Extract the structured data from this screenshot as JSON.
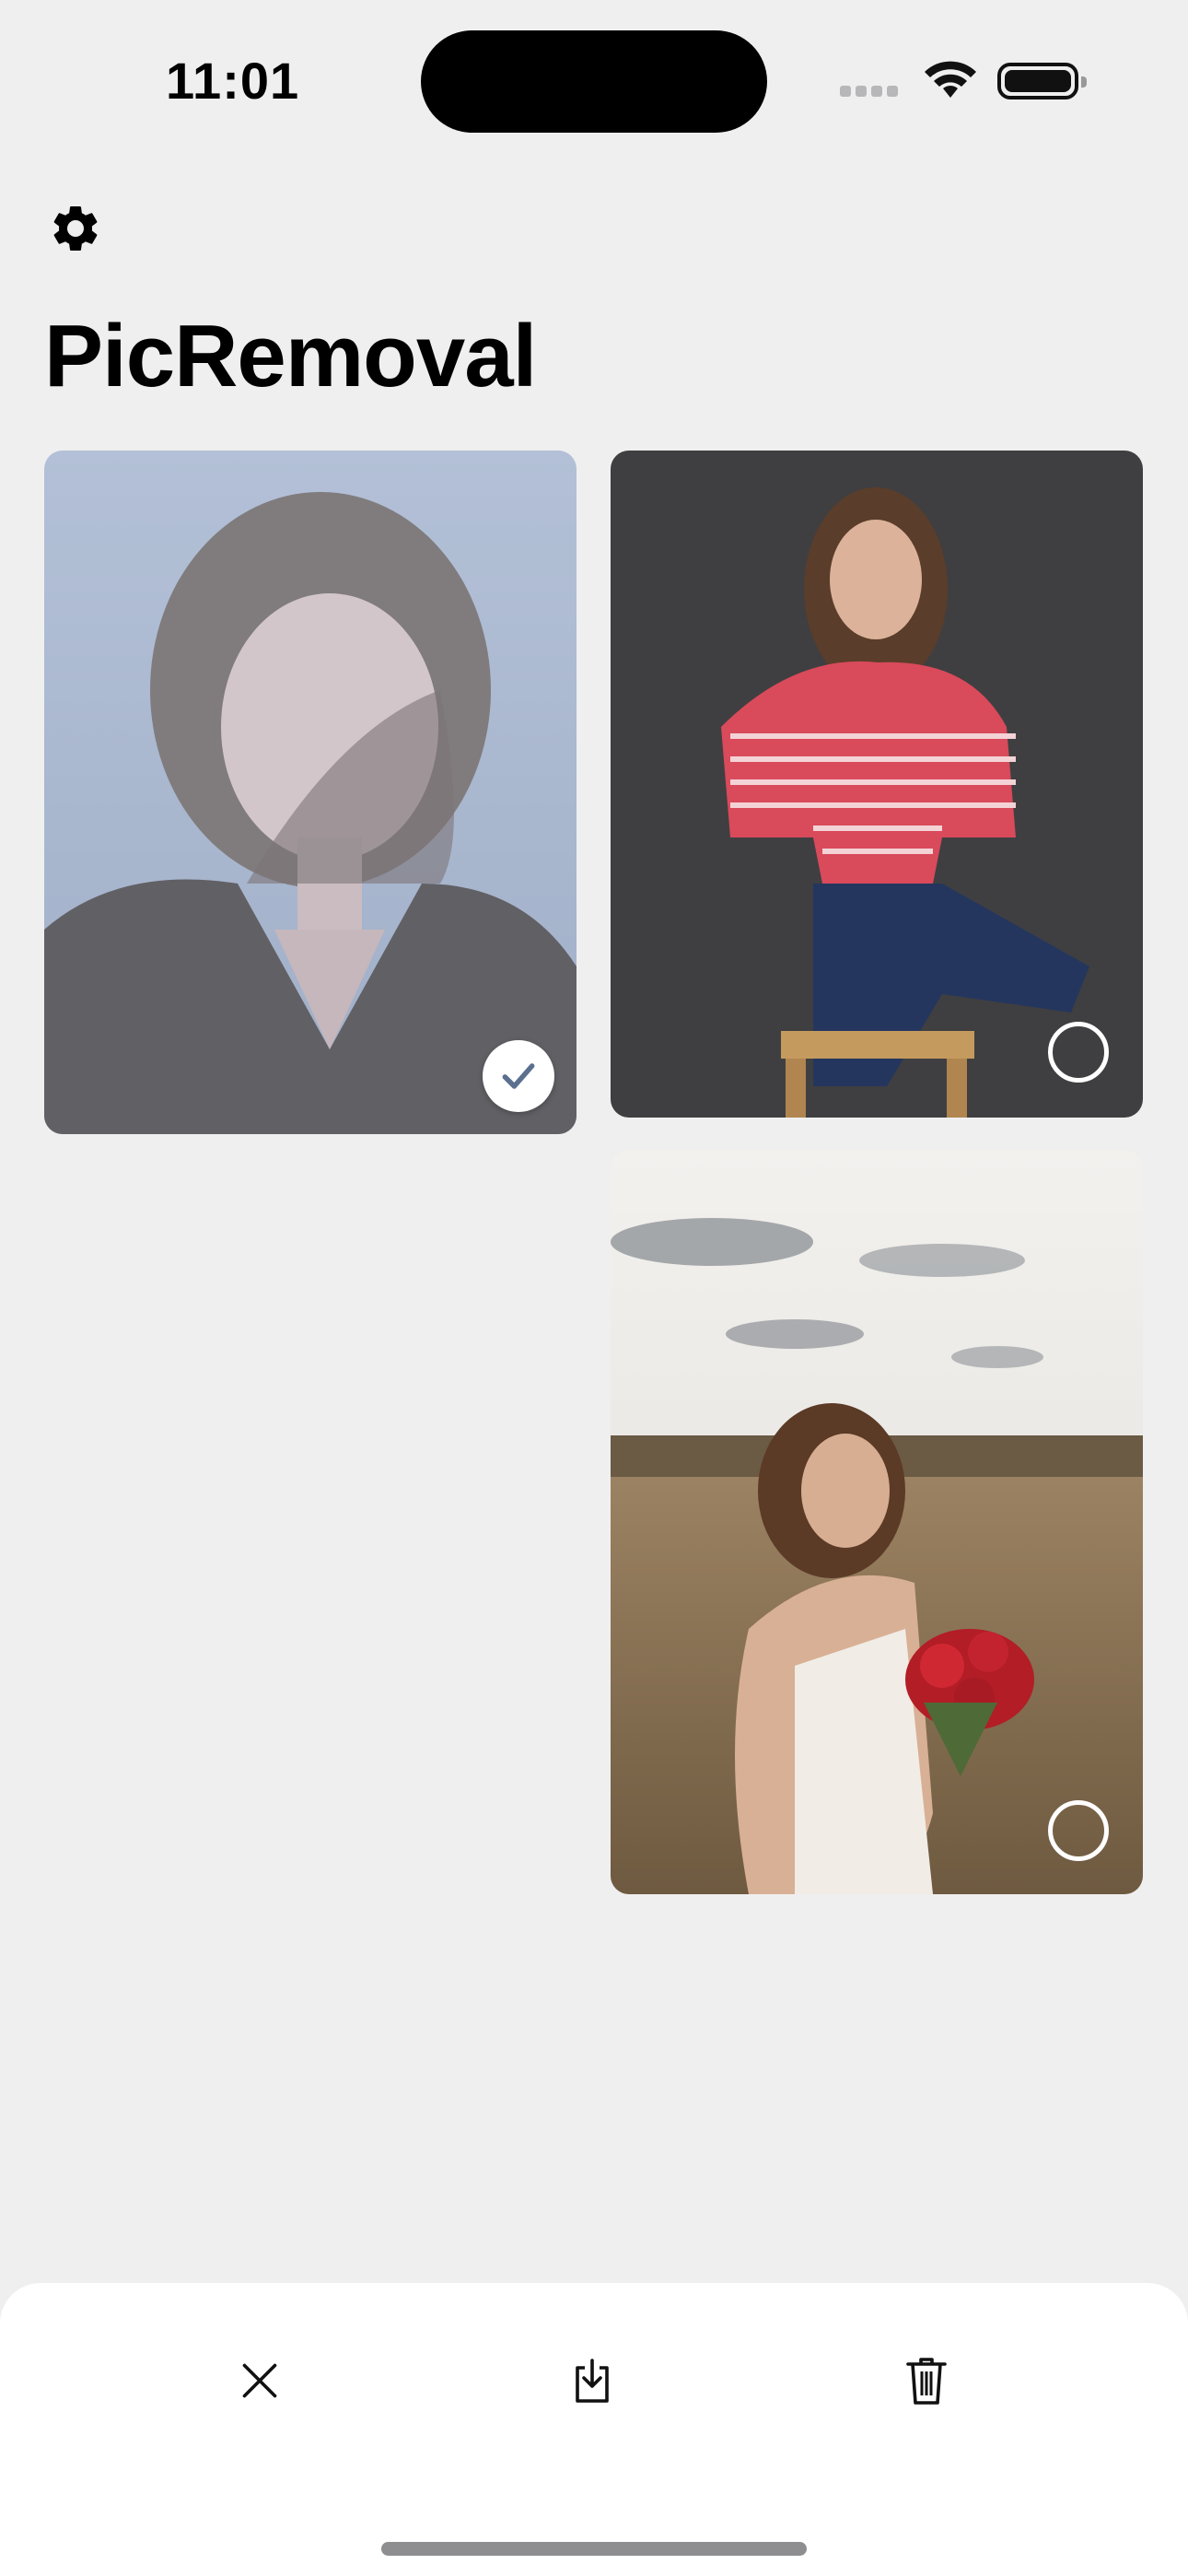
{
  "status_bar": {
    "time": "11:01",
    "icons": [
      "cellular-signal-icon",
      "wifi-icon",
      "battery-icon"
    ]
  },
  "header": {
    "settings_icon": "gear-icon",
    "title": "PicRemoval"
  },
  "photos": [
    {
      "subject": "woman with wavy hair in dark shirt on blue background",
      "selected": true
    },
    {
      "subject": "woman in red striped shirt sitting on stool",
      "selected": false
    },
    {
      "subject": "woman holding red roses in a field",
      "selected": false
    }
  ],
  "toolbar": {
    "buttons": [
      {
        "icon": "close-icon",
        "action": "cancel"
      },
      {
        "icon": "download-icon",
        "action": "save"
      },
      {
        "icon": "trash-icon",
        "action": "delete"
      }
    ]
  },
  "colors": {
    "background": "#efeff0",
    "toolbar": "#ffffff",
    "selection_check": "#5b6f8f"
  }
}
